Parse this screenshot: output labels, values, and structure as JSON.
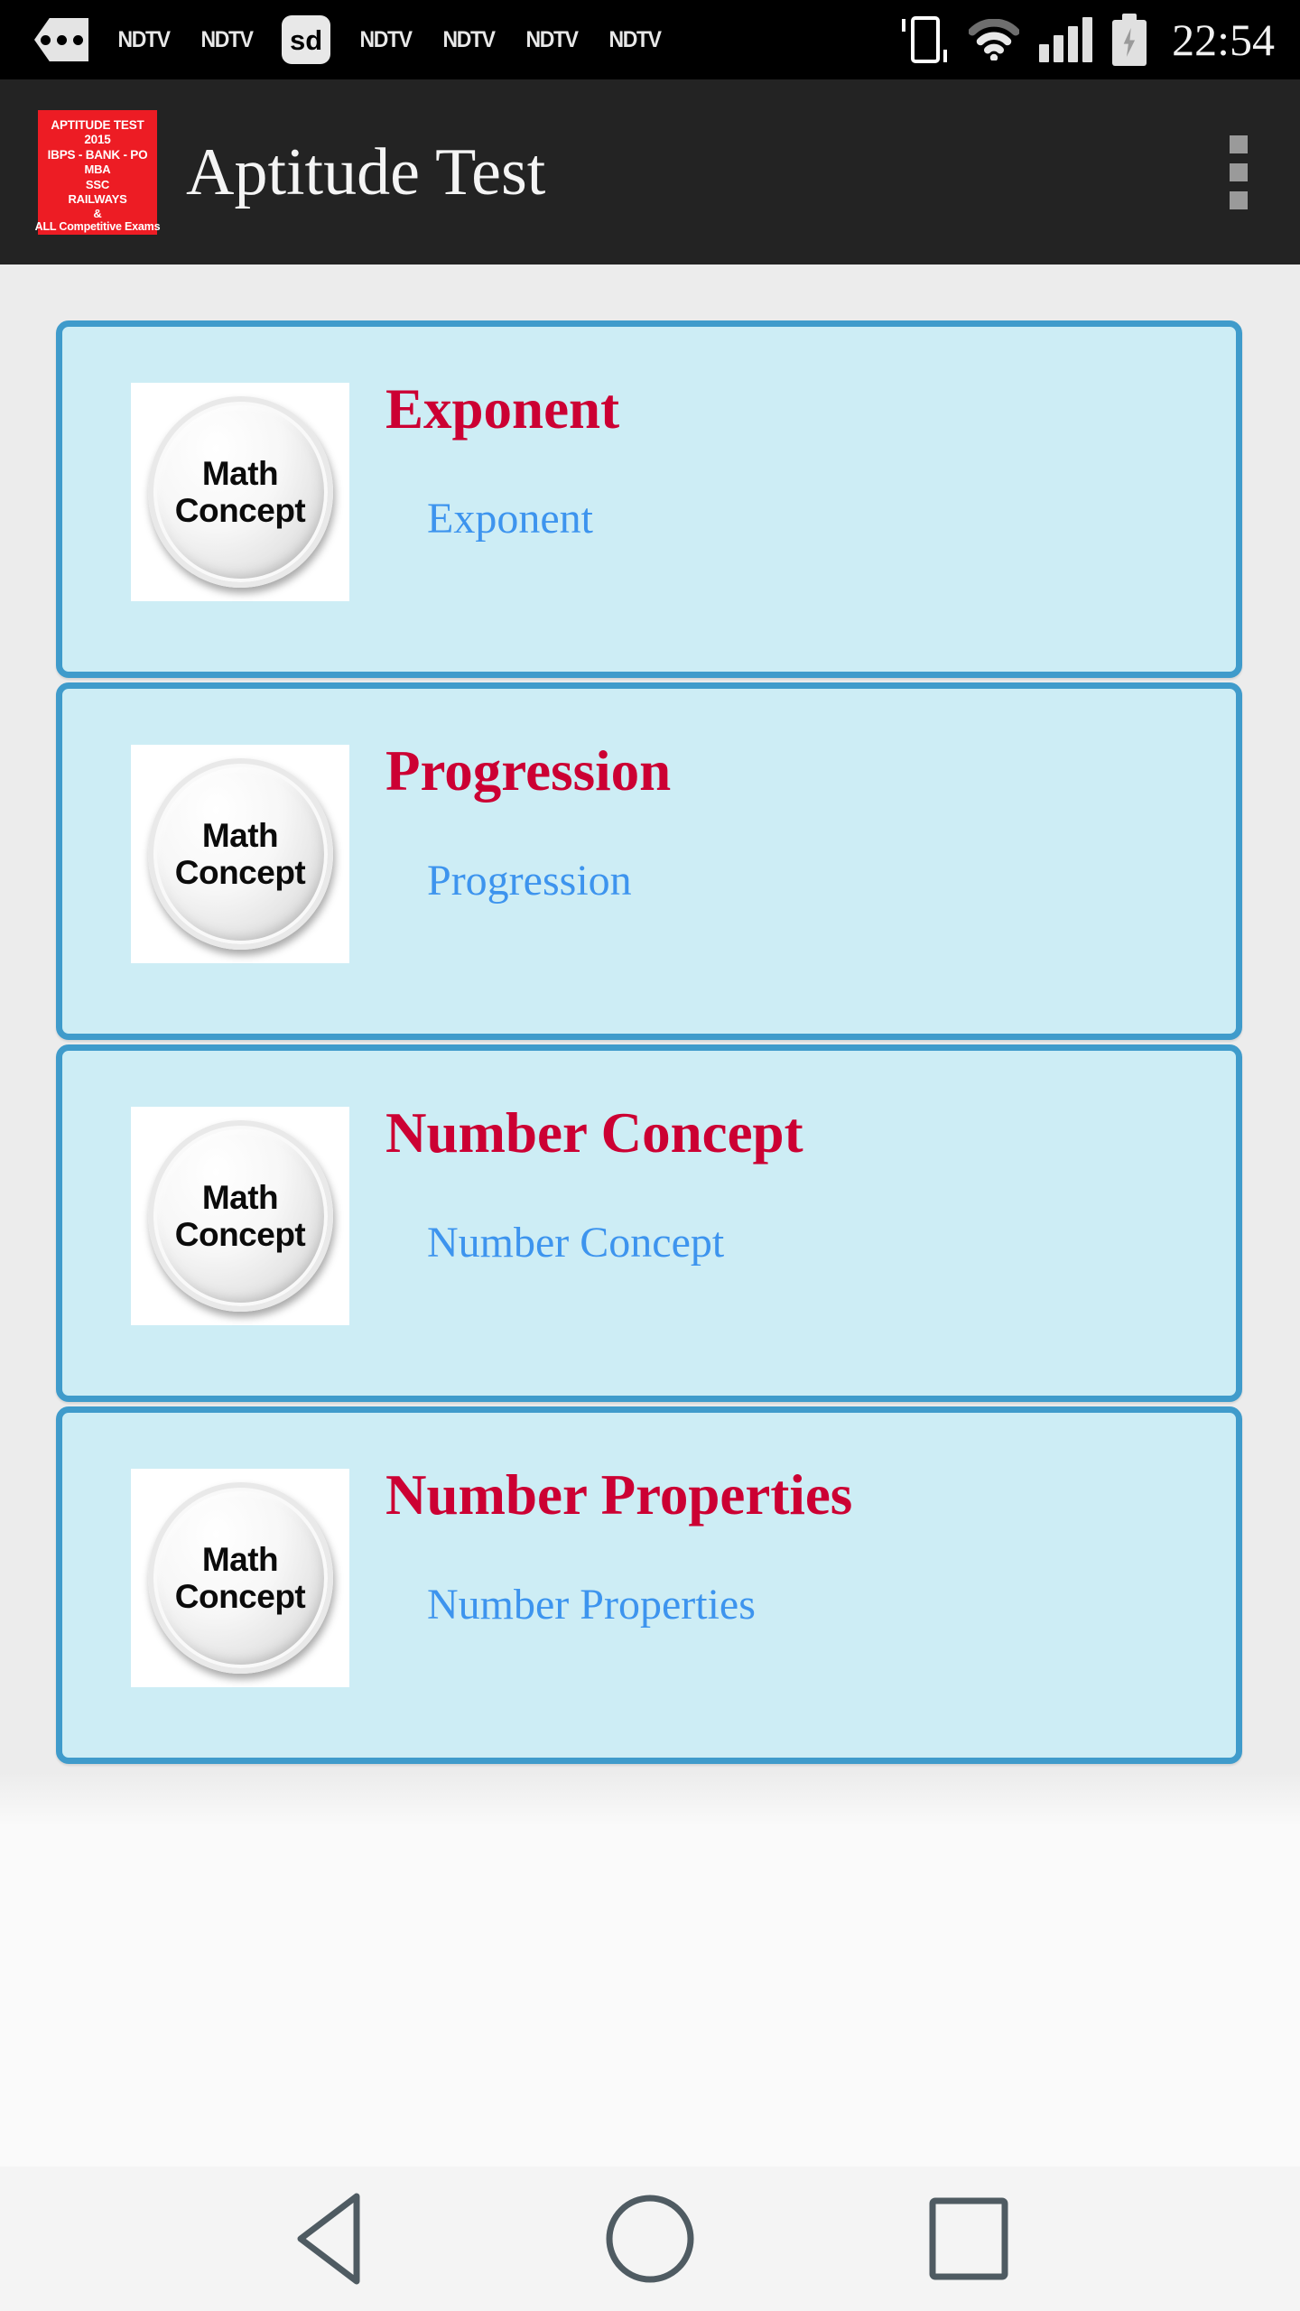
{
  "status_bar": {
    "notifications": [
      {
        "icon": "more-notifications-icon",
        "label": ""
      },
      {
        "icon": "ndtv-notification-icon",
        "label": "NDTV"
      },
      {
        "icon": "ndtv-notification-icon",
        "label": "NDTV"
      },
      {
        "icon": "sd-card-icon",
        "label": "sd"
      },
      {
        "icon": "ndtv-notification-icon",
        "label": "NDTV"
      },
      {
        "icon": "ndtv-notification-icon",
        "label": "NDTV"
      },
      {
        "icon": "ndtv-notification-icon",
        "label": "NDTV"
      },
      {
        "icon": "ndtv-notification-icon",
        "label": "NDTV"
      }
    ],
    "vibrate_icon": "vibrate-icon",
    "wifi_icon": "wifi-icon",
    "signal_icon": "cellular-signal-icon",
    "signal_bars": 4,
    "battery_icon": "battery-charging-icon",
    "time": "22:54"
  },
  "app_bar": {
    "icon_name": "app-logo-icon",
    "icon_lines": [
      "APTITUDE TEST",
      "2015",
      "IBPS - BANK - PO",
      "MBA",
      "SSC",
      "RAILWAYS",
      "&"
    ],
    "icon_footer": "ALL Competitive Exams",
    "title": "Aptitude Test",
    "overflow_icon": "overflow-menu-icon",
    "colors": {
      "bar_background": "#232323",
      "icon_background": "#ED1C24",
      "title_text": "#F4F4F4"
    }
  },
  "main": {
    "background": "#ECECEC",
    "card_styles": {
      "background": "#CDEDF5",
      "border": "#3F9BCB",
      "title_color": "#CC0033",
      "subtitle_color": "#3D94EE"
    },
    "cards": [
      {
        "title": "Exponent",
        "subtitle": "Exponent",
        "thumb_line1": "Math",
        "thumb_line2": "Concept",
        "thumb_icon": "math-concept-badge-icon"
      },
      {
        "title": "Progression",
        "subtitle": "Progression",
        "thumb_line1": "Math",
        "thumb_line2": "Concept",
        "thumb_icon": "math-concept-badge-icon"
      },
      {
        "title": "Number Concept",
        "subtitle": "Number Concept",
        "thumb_line1": "Math",
        "thumb_line2": "Concept",
        "thumb_icon": "math-concept-badge-icon"
      },
      {
        "title": "Number Properties",
        "subtitle": "Number Properties",
        "thumb_line1": "Math",
        "thumb_line2": "Concept",
        "thumb_icon": "math-concept-badge-icon"
      }
    ]
  },
  "nav_bar": {
    "background": "#F4F4F4",
    "icon_color": "#4F5B62",
    "buttons": [
      {
        "name": "back-button",
        "icon": "back-triangle-icon"
      },
      {
        "name": "home-button",
        "icon": "home-circle-icon"
      },
      {
        "name": "recents-button",
        "icon": "recents-square-icon"
      }
    ]
  }
}
